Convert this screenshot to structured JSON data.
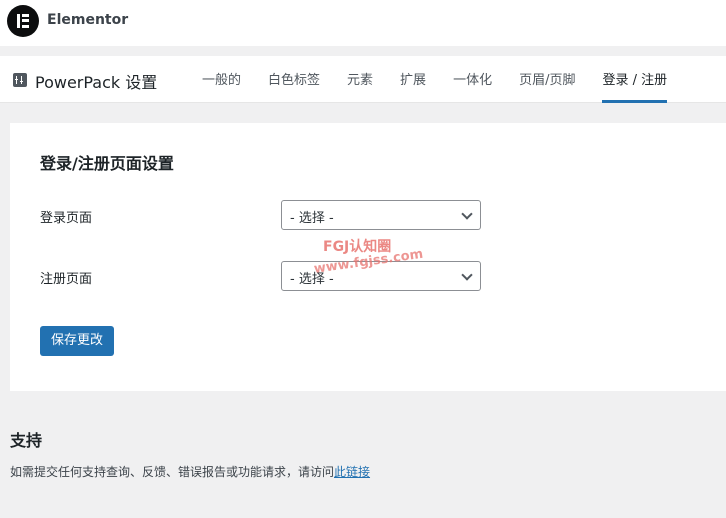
{
  "header": {
    "brand": "Elementor",
    "logo_icon": "elementor-logo-icon"
  },
  "nav": {
    "title": "PowerPack 设置",
    "title_icon": "powerpack-settings-icon",
    "tabs": [
      {
        "label": "一般的",
        "active": false
      },
      {
        "label": "白色标签",
        "active": false
      },
      {
        "label": "元素",
        "active": false
      },
      {
        "label": "扩展",
        "active": false
      },
      {
        "label": "一体化",
        "active": false
      },
      {
        "label": "页眉/页脚",
        "active": false
      },
      {
        "label": "登录 / 注册",
        "active": true
      }
    ]
  },
  "form": {
    "title": "登录/注册页面设置",
    "login_label": "登录页面",
    "login_select": "- 选择 -",
    "register_label": "注册页面",
    "register_select": "- 选择 -",
    "save_label": "保存更改"
  },
  "watermark": {
    "line1": "FGJ认知圈",
    "line2": "www.fgjss.com"
  },
  "support": {
    "title": "支持",
    "text": "如需提交任何支持查询、反馈、错误报告或功能请求，请访问",
    "link_text": "此链接"
  },
  "colors": {
    "accent": "#2271b1",
    "background": "#f0f0f1",
    "watermark": "#e8746f"
  }
}
